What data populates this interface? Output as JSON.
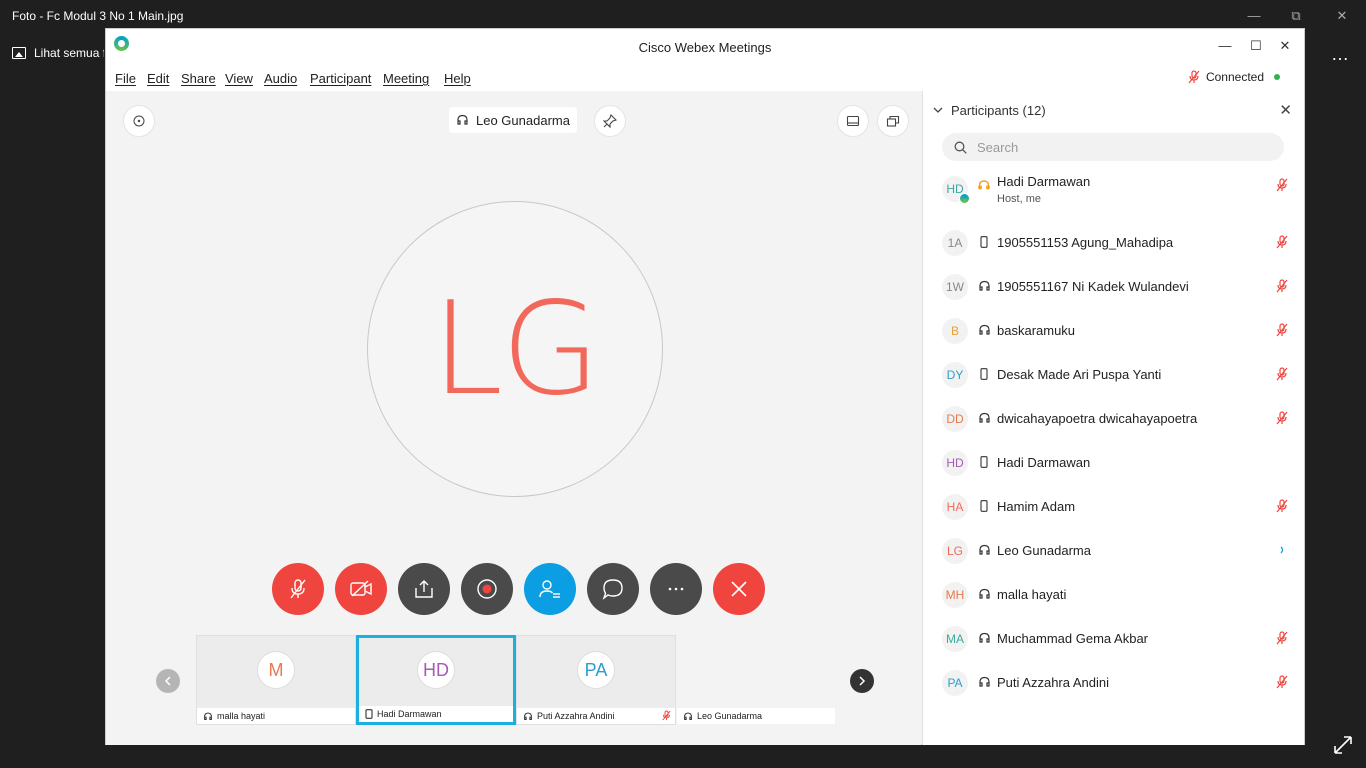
{
  "photos": {
    "title": "Foto - Fc Modul 3 No 1 Main.jpg",
    "see_all_label": "Lihat semua foto",
    "more_label": "…"
  },
  "webex": {
    "title": "Cisco Webex Meetings",
    "menu": [
      "File",
      "Edit",
      "Share",
      "View",
      "Audio",
      "Participant",
      "Meeting",
      "Help"
    ],
    "status": "Connected",
    "active_speaker": "Leo Gunadarma",
    "active_initials": "LG",
    "colors": {
      "red": "#f0453e",
      "dark": "#4a4a4a",
      "blue": "#0b9ee2",
      "highlight": "#1ab1e0",
      "initials": "#f2695b"
    }
  },
  "filmstrip": [
    {
      "initials": "M",
      "name": "malla hayati",
      "color": "#e8794f",
      "device": "headset",
      "muted": false,
      "active": false
    },
    {
      "initials": "HD",
      "name": "Hadi Darmawan",
      "color": "#a75bb5",
      "device": "phone",
      "muted": false,
      "active": true
    },
    {
      "initials": "PA",
      "name": "Puti Azzahra Andini",
      "color": "#2a9fd0",
      "device": "headset",
      "muted": true,
      "active": false
    },
    {
      "initials": "",
      "name": "Leo Gunadarma",
      "color": "#f2695b",
      "device": "headset",
      "muted": false,
      "active": false
    }
  ],
  "participants": {
    "header": "Participants (12)",
    "search_placeholder": "Search",
    "items": [
      {
        "initials": "HD",
        "name": "Hadi Darmawan",
        "sub": "Host, me",
        "color": "#3aa9a0",
        "device": "host",
        "muted": true
      },
      {
        "initials": "1A",
        "name": "1905551153 Agung_Mahadipa",
        "sub": "",
        "color": "#888888",
        "device": "phone",
        "muted": true
      },
      {
        "initials": "1W",
        "name": "1905551167 Ni Kadek Wulandevi",
        "sub": "",
        "color": "#888888",
        "device": "headset",
        "muted": true
      },
      {
        "initials": "B",
        "name": "baskaramuku",
        "sub": "",
        "color": "#e8a23a",
        "device": "headset",
        "muted": true
      },
      {
        "initials": "DY",
        "name": "Desak Made Ari Puspa Yanti",
        "sub": "",
        "color": "#2a9fd0",
        "device": "phone",
        "muted": true
      },
      {
        "initials": "DD",
        "name": "dwicahayapoetra dwicahayapoetra",
        "sub": "",
        "color": "#e8794f",
        "device": "headset",
        "muted": true
      },
      {
        "initials": "HD",
        "name": "Hadi Darmawan",
        "sub": "",
        "color": "#a75bb5",
        "device": "phone",
        "muted": false
      },
      {
        "initials": "HA",
        "name": "Hamim Adam",
        "sub": "",
        "color": "#f2695b",
        "device": "phone",
        "muted": true
      },
      {
        "initials": "LG",
        "name": "Leo Gunadarma",
        "sub": "",
        "color": "#f2695b",
        "device": "headset",
        "muted": false,
        "speaking": true
      },
      {
        "initials": "MH",
        "name": "malla hayati",
        "sub": "",
        "color": "#e8794f",
        "device": "headset",
        "muted": false
      },
      {
        "initials": "MA",
        "name": "Muchammad Gema Akbar",
        "sub": "",
        "color": "#3aa9a0",
        "device": "headset",
        "muted": true
      },
      {
        "initials": "PA",
        "name": "Puti Azzahra Andini",
        "sub": "",
        "color": "#2a9fd0",
        "device": "headset",
        "muted": true
      }
    ]
  }
}
